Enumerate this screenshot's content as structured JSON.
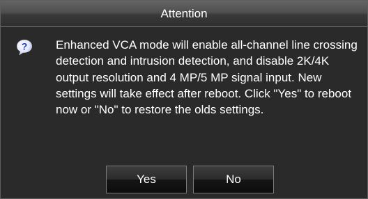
{
  "dialog": {
    "title": "Attention",
    "message": "Enhanced VCA mode will enable all-channel line crossing detection and intrusion detection, and disable 2K/4K output resolution and 4 MP/5 MP signal input. New settings will take effect after reboot. Click \"Yes\" to reboot now or \"No\" to restore the olds settings.",
    "icon": "question-icon",
    "icon_glyph": "?",
    "buttons": {
      "yes": "Yes",
      "no": "No"
    }
  },
  "colors": {
    "background": "#2a2a2a",
    "text": "#ffffff",
    "icon_fill": "#1f3fbf"
  }
}
